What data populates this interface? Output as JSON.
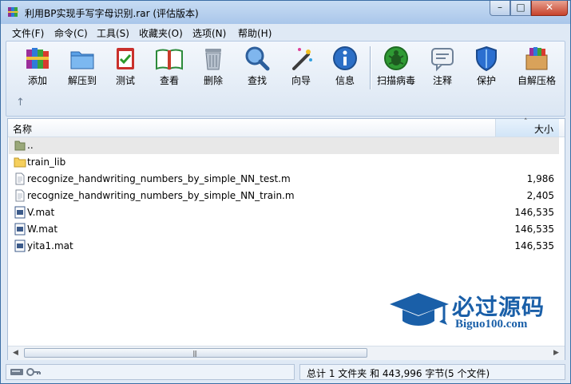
{
  "window": {
    "title": "利用BP实现手写字母识别.rar (评估版本)",
    "controls": {
      "minimize": "–",
      "maximize": "□",
      "close": "✕"
    }
  },
  "menu": [
    "文件(F)",
    "命令(C)",
    "工具(S)",
    "收藏夹(O)",
    "选项(N)",
    "帮助(H)"
  ],
  "toolbar": {
    "buttons": [
      {
        "label": "添加",
        "icon": "books-add-icon"
      },
      {
        "label": "解压到",
        "icon": "folder-extract-icon"
      },
      {
        "label": "测试",
        "icon": "clipboard-test-icon"
      },
      {
        "label": "查看",
        "icon": "book-view-icon"
      },
      {
        "label": "删除",
        "icon": "trash-delete-icon"
      },
      {
        "label": "查找",
        "icon": "magnifier-find-icon"
      },
      {
        "label": "向导",
        "icon": "wand-wizard-icon"
      },
      {
        "label": "信息",
        "icon": "info-icon"
      },
      {
        "label": "扫描病毒",
        "icon": "bug-scan-icon"
      },
      {
        "label": "注释",
        "icon": "comment-icon"
      },
      {
        "label": "保护",
        "icon": "shield-protect-icon"
      },
      {
        "label": "自解压格",
        "icon": "box-sfx-icon"
      }
    ],
    "up_arrow": "↑"
  },
  "file_list": {
    "columns": {
      "name": "名称",
      "size": "大小"
    },
    "sort_indicator": "˄",
    "rows": [
      {
        "name": "..",
        "size": "",
        "type": "folder-up"
      },
      {
        "name": "train_lib",
        "size": "",
        "type": "folder"
      },
      {
        "name": "recognize_handwriting_numbers_by_simple_NN_test.m",
        "size": "1,986",
        "type": "file"
      },
      {
        "name": "recognize_handwriting_numbers_by_simple_NN_train.m",
        "size": "2,405",
        "type": "file"
      },
      {
        "name": "V.mat",
        "size": "146,535",
        "type": "mat"
      },
      {
        "name": "W.mat",
        "size": "146,535",
        "type": "mat"
      },
      {
        "name": "yita1.mat",
        "size": "146,535",
        "type": "mat"
      }
    ]
  },
  "scrollbar": {
    "left_arrow": "◀",
    "right_arrow": "▶",
    "grip": "|||"
  },
  "status": {
    "summary": "总计 1 文件夹 和 443,996 字节(5 个文件)"
  },
  "watermark": {
    "cn": "必过源码",
    "en": "Biguo100.com"
  },
  "colors": {
    "accent": "#1a5fa8",
    "titlebar": "#b6cff0",
    "close": "#c7432c"
  }
}
